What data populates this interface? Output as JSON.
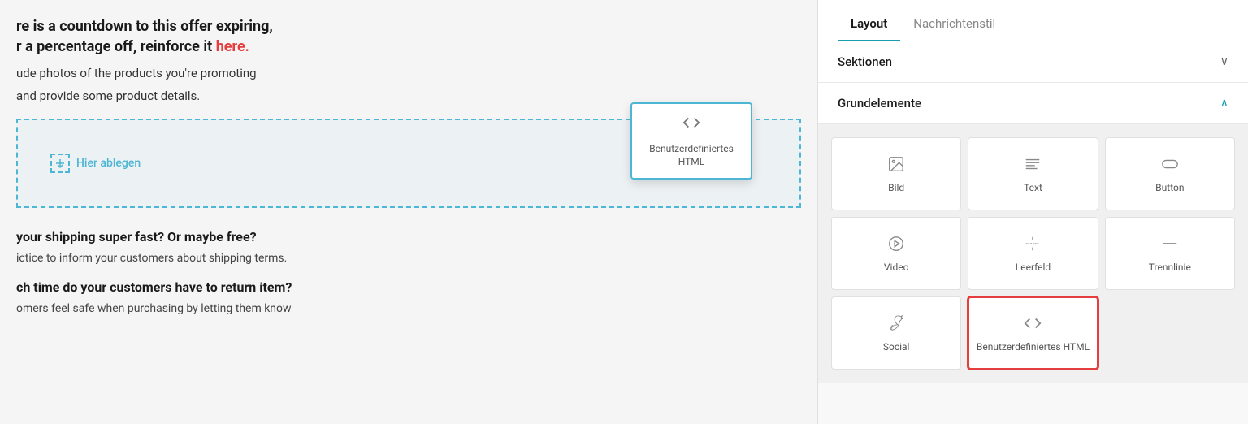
{
  "tabs": {
    "layout_label": "Layout",
    "style_label": "Nachrichtenstil"
  },
  "sections": {
    "sektionen": {
      "label": "Sektionen",
      "collapsed": true
    },
    "grundelemente": {
      "label": "Grundelemente",
      "collapsed": false
    }
  },
  "elements": [
    {
      "id": "bild",
      "label": "Bild",
      "icon": "image"
    },
    {
      "id": "text",
      "label": "Text",
      "icon": "text"
    },
    {
      "id": "button",
      "label": "Button",
      "icon": "button"
    },
    {
      "id": "video",
      "label": "Video",
      "icon": "video"
    },
    {
      "id": "leerfeld",
      "label": "Leerfeld",
      "icon": "leerfeld"
    },
    {
      "id": "trennlinie",
      "label": "Trennlinie",
      "icon": "trennlinie"
    },
    {
      "id": "social",
      "label": "Social",
      "icon": "social"
    },
    {
      "id": "html",
      "label": "Benutzerdefiniertes HTML",
      "icon": "code",
      "selected": true
    }
  ],
  "email": {
    "line1": "re is a countdown to this offer expiring,",
    "line2_prefix": "r a percentage off, reinforce it ",
    "line2_link": "here.",
    "line3": "ude photos of the products you're promoting",
    "line4": "and provide some product details.",
    "drop_zone_label": "Hier ablegen",
    "dragged_element_label": "Benutzerdefiniertes\nHTML",
    "section1_heading": "your shipping super fast? Or maybe free?",
    "section1_text": "ictice to inform your customers about shipping terms.",
    "section2_heading": "ch time do your customers have to return item?",
    "section2_text": "omers feel safe when purchasing by letting them know"
  }
}
